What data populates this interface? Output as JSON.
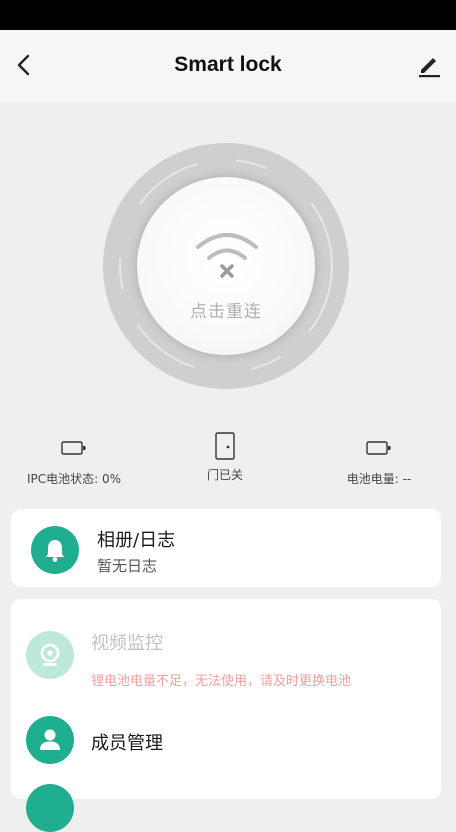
{
  "header": {
    "title": "Smart lock",
    "back_icon": "chevron-left-icon",
    "edit_icon": "pencil-icon"
  },
  "lock": {
    "reconnect_label": "点击重连",
    "status_icon": "wifi-off-icon"
  },
  "stats": {
    "ipc_battery": "IPC电池状态: 0%",
    "door": "门已关",
    "battery_level": "电池电量: --"
  },
  "album": {
    "title": "相册/日志",
    "subtitle": "暂无日志",
    "icon": "bell-icon"
  },
  "features": {
    "video": {
      "title": "视频监控",
      "warning": "锂电池电量不足，无法使用，请及时更换电池",
      "icon": "camera-icon"
    },
    "members": {
      "title": "成员管理",
      "icon": "user-icon"
    }
  },
  "colors": {
    "accent": "#1fae8f",
    "accent_faded": "#bfe8dd",
    "warning": "#f1a0a0",
    "ring": "#cfcfcf"
  }
}
